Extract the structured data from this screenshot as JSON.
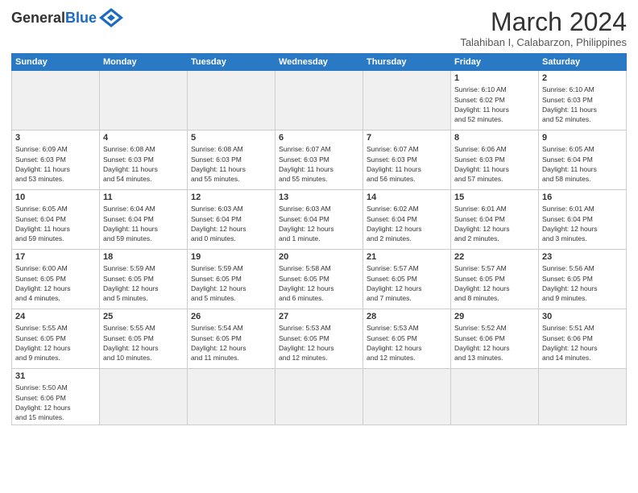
{
  "header": {
    "logo_general": "General",
    "logo_blue": "Blue",
    "title": "March 2024",
    "subtitle": "Talahiban I, Calabarzon, Philippines"
  },
  "weekdays": [
    "Sunday",
    "Monday",
    "Tuesday",
    "Wednesday",
    "Thursday",
    "Friday",
    "Saturday"
  ],
  "weeks": [
    [
      {
        "day": "",
        "info": ""
      },
      {
        "day": "",
        "info": ""
      },
      {
        "day": "",
        "info": ""
      },
      {
        "day": "",
        "info": ""
      },
      {
        "day": "",
        "info": ""
      },
      {
        "day": "1",
        "info": "Sunrise: 6:10 AM\nSunset: 6:02 PM\nDaylight: 11 hours\nand 52 minutes."
      },
      {
        "day": "2",
        "info": "Sunrise: 6:10 AM\nSunset: 6:03 PM\nDaylight: 11 hours\nand 52 minutes."
      }
    ],
    [
      {
        "day": "3",
        "info": "Sunrise: 6:09 AM\nSunset: 6:03 PM\nDaylight: 11 hours\nand 53 minutes."
      },
      {
        "day": "4",
        "info": "Sunrise: 6:08 AM\nSunset: 6:03 PM\nDaylight: 11 hours\nand 54 minutes."
      },
      {
        "day": "5",
        "info": "Sunrise: 6:08 AM\nSunset: 6:03 PM\nDaylight: 11 hours\nand 55 minutes."
      },
      {
        "day": "6",
        "info": "Sunrise: 6:07 AM\nSunset: 6:03 PM\nDaylight: 11 hours\nand 55 minutes."
      },
      {
        "day": "7",
        "info": "Sunrise: 6:07 AM\nSunset: 6:03 PM\nDaylight: 11 hours\nand 56 minutes."
      },
      {
        "day": "8",
        "info": "Sunrise: 6:06 AM\nSunset: 6:03 PM\nDaylight: 11 hours\nand 57 minutes."
      },
      {
        "day": "9",
        "info": "Sunrise: 6:05 AM\nSunset: 6:04 PM\nDaylight: 11 hours\nand 58 minutes."
      }
    ],
    [
      {
        "day": "10",
        "info": "Sunrise: 6:05 AM\nSunset: 6:04 PM\nDaylight: 11 hours\nand 59 minutes."
      },
      {
        "day": "11",
        "info": "Sunrise: 6:04 AM\nSunset: 6:04 PM\nDaylight: 11 hours\nand 59 minutes."
      },
      {
        "day": "12",
        "info": "Sunrise: 6:03 AM\nSunset: 6:04 PM\nDaylight: 12 hours\nand 0 minutes."
      },
      {
        "day": "13",
        "info": "Sunrise: 6:03 AM\nSunset: 6:04 PM\nDaylight: 12 hours\nand 1 minute."
      },
      {
        "day": "14",
        "info": "Sunrise: 6:02 AM\nSunset: 6:04 PM\nDaylight: 12 hours\nand 2 minutes."
      },
      {
        "day": "15",
        "info": "Sunrise: 6:01 AM\nSunset: 6:04 PM\nDaylight: 12 hours\nand 2 minutes."
      },
      {
        "day": "16",
        "info": "Sunrise: 6:01 AM\nSunset: 6:04 PM\nDaylight: 12 hours\nand 3 minutes."
      }
    ],
    [
      {
        "day": "17",
        "info": "Sunrise: 6:00 AM\nSunset: 6:05 PM\nDaylight: 12 hours\nand 4 minutes."
      },
      {
        "day": "18",
        "info": "Sunrise: 5:59 AM\nSunset: 6:05 PM\nDaylight: 12 hours\nand 5 minutes."
      },
      {
        "day": "19",
        "info": "Sunrise: 5:59 AM\nSunset: 6:05 PM\nDaylight: 12 hours\nand 5 minutes."
      },
      {
        "day": "20",
        "info": "Sunrise: 5:58 AM\nSunset: 6:05 PM\nDaylight: 12 hours\nand 6 minutes."
      },
      {
        "day": "21",
        "info": "Sunrise: 5:57 AM\nSunset: 6:05 PM\nDaylight: 12 hours\nand 7 minutes."
      },
      {
        "day": "22",
        "info": "Sunrise: 5:57 AM\nSunset: 6:05 PM\nDaylight: 12 hours\nand 8 minutes."
      },
      {
        "day": "23",
        "info": "Sunrise: 5:56 AM\nSunset: 6:05 PM\nDaylight: 12 hours\nand 9 minutes."
      }
    ],
    [
      {
        "day": "24",
        "info": "Sunrise: 5:55 AM\nSunset: 6:05 PM\nDaylight: 12 hours\nand 9 minutes."
      },
      {
        "day": "25",
        "info": "Sunrise: 5:55 AM\nSunset: 6:05 PM\nDaylight: 12 hours\nand 10 minutes."
      },
      {
        "day": "26",
        "info": "Sunrise: 5:54 AM\nSunset: 6:05 PM\nDaylight: 12 hours\nand 11 minutes."
      },
      {
        "day": "27",
        "info": "Sunrise: 5:53 AM\nSunset: 6:05 PM\nDaylight: 12 hours\nand 12 minutes."
      },
      {
        "day": "28",
        "info": "Sunrise: 5:53 AM\nSunset: 6:05 PM\nDaylight: 12 hours\nand 12 minutes."
      },
      {
        "day": "29",
        "info": "Sunrise: 5:52 AM\nSunset: 6:06 PM\nDaylight: 12 hours\nand 13 minutes."
      },
      {
        "day": "30",
        "info": "Sunrise: 5:51 AM\nSunset: 6:06 PM\nDaylight: 12 hours\nand 14 minutes."
      }
    ],
    [
      {
        "day": "31",
        "info": "Sunrise: 5:50 AM\nSunset: 6:06 PM\nDaylight: 12 hours\nand 15 minutes."
      },
      {
        "day": "",
        "info": ""
      },
      {
        "day": "",
        "info": ""
      },
      {
        "day": "",
        "info": ""
      },
      {
        "day": "",
        "info": ""
      },
      {
        "day": "",
        "info": ""
      },
      {
        "day": "",
        "info": ""
      }
    ]
  ]
}
